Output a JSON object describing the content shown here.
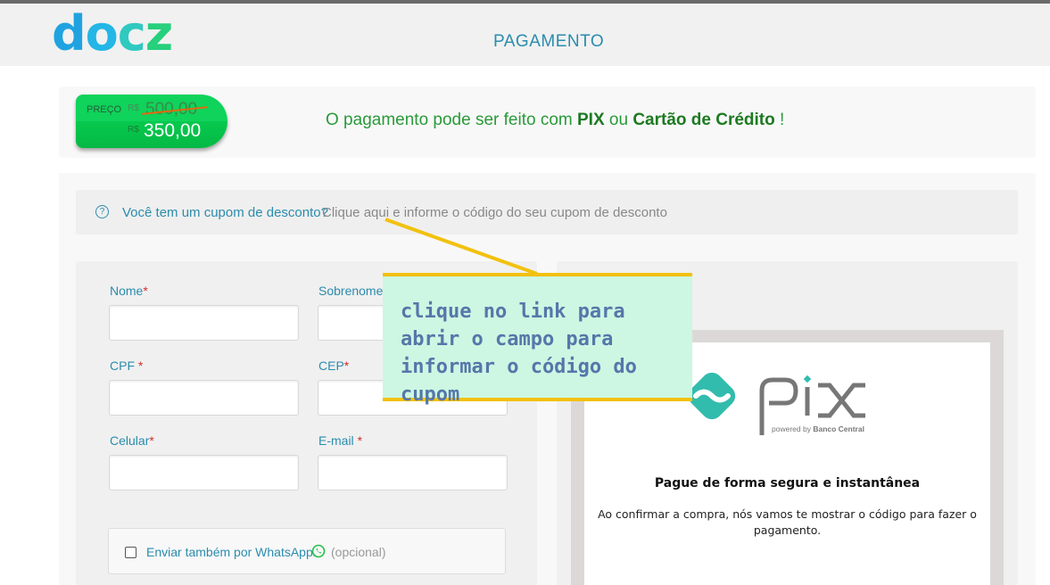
{
  "app": {
    "logo_text": "docz",
    "page_title": "PAGAMENTO"
  },
  "price": {
    "label": "PREÇO",
    "currency": "R$",
    "old_value": "500,00",
    "new_value": "350,00"
  },
  "payment_message": {
    "prefix": "O pagamento pode ser feito com ",
    "pix": "PIX",
    "middle": " ou ",
    "card": "Cartão de Crédito",
    "suffix": " !"
  },
  "coupon": {
    "help_icon": "question-circle-icon",
    "question": "Você tem um cupom de desconto?",
    "link_text": "Clique aqui e informe o código do seu cupom de desconto"
  },
  "form": {
    "required_mark": "*",
    "fields": [
      {
        "label": "Nome",
        "value": ""
      },
      {
        "label": "Sobrenome",
        "value": ""
      },
      {
        "label": "CPF",
        "value": ""
      },
      {
        "label": "CEP",
        "value": ""
      },
      {
        "label": "Celular",
        "value": ""
      },
      {
        "label": "E-mail",
        "value": ""
      }
    ],
    "whatsapp": {
      "label": "Enviar também por WhatsApp",
      "icon": "whatsapp-icon",
      "optional": "(opcional)",
      "checked": false
    }
  },
  "pix": {
    "logo_word": "pix",
    "powered_by": "powered by",
    "bank": "Banco Central",
    "title": "Pague de forma segura e instantânea",
    "description": "Ao confirmar a compra, nós vamos te mostrar o código para fazer o pagamento."
  },
  "annotation": {
    "text": "clique no link para abrir o campo para informar o código do cupom"
  },
  "colors": {
    "accent": "#2b8cad",
    "green": "#2a9a3a",
    "callout_bg": "#cdf7e2",
    "callout_border": "#f2c10f",
    "pix_teal": "#32bcad"
  }
}
